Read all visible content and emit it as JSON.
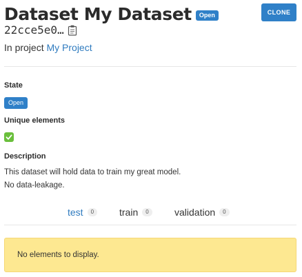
{
  "header": {
    "title": "Dataset My Dataset",
    "status_badge": "Open",
    "clone_button": "CLONE"
  },
  "dataset_id": "22cce5e0…",
  "project": {
    "prefix": "In project",
    "name": "My Project"
  },
  "state": {
    "label": "State",
    "value": "Open"
  },
  "unique_elements": {
    "label": "Unique elements",
    "value": true
  },
  "description": {
    "label": "Description",
    "line1": "This dataset will hold data to train my great model.",
    "line2": "No data-leakage."
  },
  "tabs": [
    {
      "label": "test",
      "count": "0",
      "active": true
    },
    {
      "label": "train",
      "count": "0",
      "active": false
    },
    {
      "label": "validation",
      "count": "0",
      "active": false
    }
  ],
  "empty_message": "No elements to display.",
  "colors": {
    "primary": "#2f80c8",
    "link": "#2f7bbf",
    "warning_bg": "#fde891",
    "check_green": "#6abf3c"
  },
  "icons": {
    "clipboard": "clipboard-icon",
    "check": "check-mark-icon"
  }
}
